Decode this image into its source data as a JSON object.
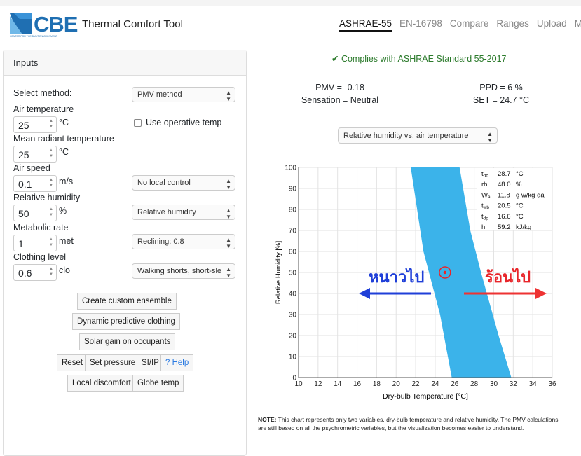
{
  "header": {
    "logo_text": "CBE",
    "logo_subtext": "CENTER FOR THE BUILT ENVIRONMENT",
    "app_title": "Thermal Comfort Tool",
    "nav": [
      "ASHRAE-55",
      "EN-16798",
      "Compare",
      "Ranges",
      "Upload",
      "MRT"
    ],
    "active_nav": "ASHRAE-55"
  },
  "inputs": {
    "title": "Inputs",
    "select_method_label": "Select method:",
    "select_method_value": "PMV method",
    "air_temp_label": "Air temperature",
    "air_temp_value": "25",
    "air_temp_unit": "°C",
    "use_operative": "Use operative temp",
    "mrt_label": "Mean radiant temperature",
    "mrt_value": "25",
    "mrt_unit": "°C",
    "air_speed_label": "Air speed",
    "air_speed_value": "0.1",
    "air_speed_unit": "m/s",
    "local_control": "No local control",
    "rh_label": "Relative humidity",
    "rh_value": "50",
    "rh_unit": "%",
    "rh_select": "Relative humidity",
    "met_label": "Metabolic rate",
    "met_value": "1",
    "met_unit": "met",
    "met_select": "Reclining: 0.8",
    "clo_label": "Clothing level",
    "clo_value": "0.6",
    "clo_unit": "clo",
    "clo_select": "Walking shorts, short-sle",
    "btn_custom": "Create custom ensemble",
    "btn_dynamic": "Dynamic predictive clothing",
    "btn_solar": "Solar gain on occupants",
    "btn_reset": "Reset",
    "btn_pressure": "Set pressure",
    "btn_siip": "SI/IP",
    "btn_help": "? Help",
    "btn_local": "Local discomfort",
    "btn_globe": "Globe temp"
  },
  "results": {
    "complies": "✔ Complies with ASHRAE Standard 55-2017",
    "pmv": "PMV = -0.18",
    "sensation": "Sensation = Neutral",
    "ppd": "PPD = 6 %",
    "set": "SET = 24.7 °C",
    "chart_select": "Relative humidity vs. air temperature"
  },
  "colors": {
    "comfort_zone": "#3bb3ea",
    "cold_arrow": "#1f3fd8",
    "hot_arrow": "#ee3333",
    "cold_text": "#1f3fd8",
    "hot_text": "#e8252a",
    "marker": "#e8252a"
  },
  "annotations": {
    "cold": "หนาวไป",
    "hot": "ร้อนไป"
  },
  "psychro": [
    {
      "sym": "t",
      "sub": "db",
      "val": "28.7",
      "unit": "°C"
    },
    {
      "sym": "rh",
      "sub": "",
      "val": "48.0",
      "unit": "%"
    },
    {
      "sym": "W",
      "sub": "a",
      "val": "11.8",
      "unit": "g w/kg da"
    },
    {
      "sym": "t",
      "sub": "wb",
      "val": "20.5",
      "unit": "°C"
    },
    {
      "sym": "t",
      "sub": "dp",
      "val": "16.6",
      "unit": "°C"
    },
    {
      "sym": "h",
      "sub": "",
      "val": "59.2",
      "unit": "kJ/kg"
    }
  ],
  "note_label": "NOTE:",
  "note_text": "This chart represents only two variables, dry-bulb temperature and relative humidity. The PMV calculations are still based on all the psychrometric variables, but the visualization becomes easier to understand.",
  "chart_data": {
    "type": "area",
    "xlabel": "Dry-bulb Temperature [°C]",
    "ylabel": "Relative Humidity [%]",
    "xlim": [
      10,
      36
    ],
    "ylim": [
      0,
      100
    ],
    "xticks": [
      10,
      12,
      14,
      16,
      18,
      20,
      22,
      24,
      26,
      28,
      30,
      32,
      34,
      36
    ],
    "yticks": [
      0,
      10,
      20,
      30,
      40,
      50,
      60,
      70,
      80,
      90,
      100
    ],
    "grid": true,
    "comfort_zone": {
      "lower_boundary": [
        {
          "x": 21.5,
          "y": 100
        },
        {
          "x": 22.8,
          "y": 60
        },
        {
          "x": 24.5,
          "y": 30
        },
        {
          "x": 25.7,
          "y": 0
        }
      ],
      "upper_boundary": [
        {
          "x": 26.5,
          "y": 100
        },
        {
          "x": 27.6,
          "y": 70
        },
        {
          "x": 28.7,
          "y": 50
        },
        {
          "x": 30.5,
          "y": 20
        },
        {
          "x": 31.8,
          "y": 0
        }
      ]
    },
    "current_point": {
      "x": 25,
      "y": 50
    }
  }
}
